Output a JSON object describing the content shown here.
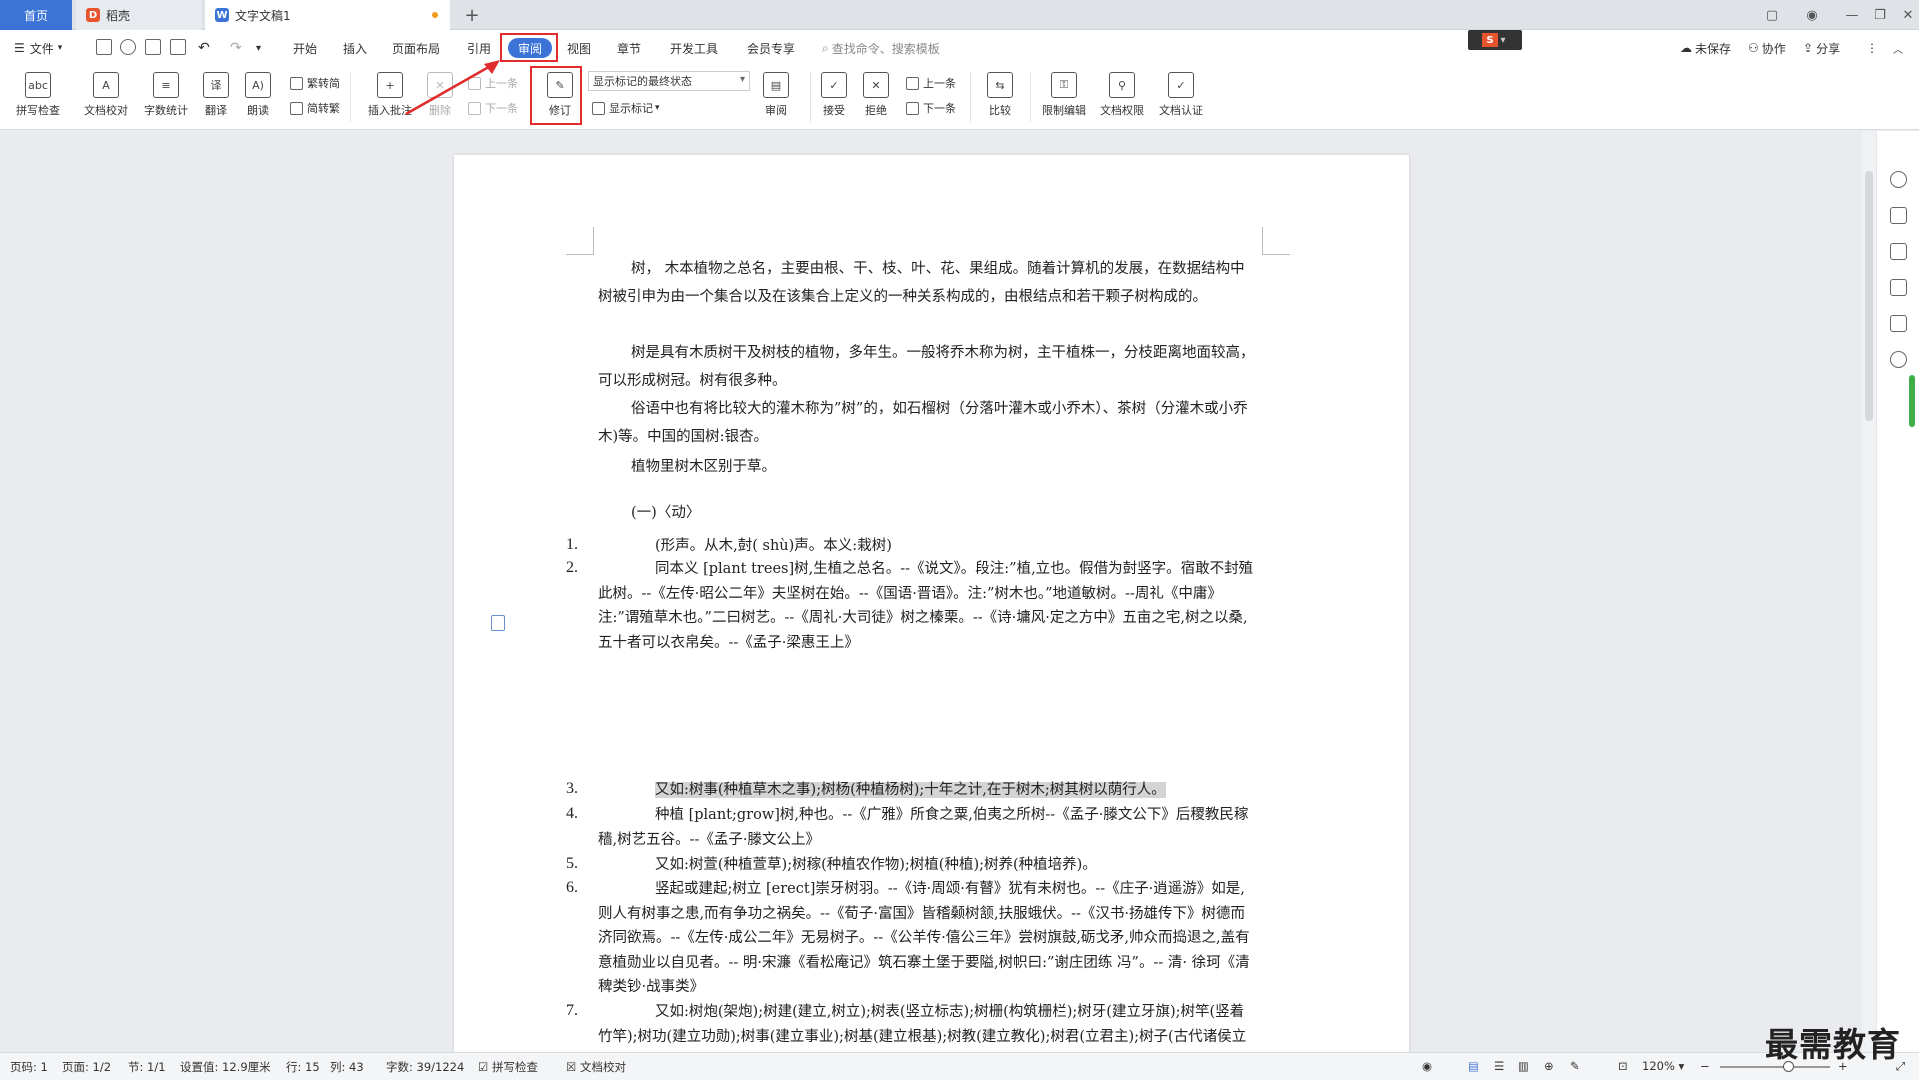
{
  "tabs": {
    "home": "首页",
    "daoke": "稻壳",
    "doc": "文字文稿1"
  },
  "menu": {
    "file": "文件",
    "items": [
      "开始",
      "插入",
      "页面布局",
      "引用",
      "审阅",
      "视图",
      "章节",
      "开发工具",
      "会员专享"
    ],
    "search": "查找命令、搜索模板",
    "unsaved": "未保存",
    "collab": "协作",
    "share": "分享"
  },
  "ribbon": {
    "spell": "拼写检查",
    "proof": "文档校对",
    "wordcount": "字数统计",
    "translate": "翻译",
    "read": "朗读",
    "trad": "繁转简",
    "simp": "简转繁",
    "insert_comment": "插入批注",
    "delete": "删除",
    "prev_comment": "上一条",
    "next_comment": "下一条",
    "revise": "修订",
    "markup_state": "显示标记的最终状态",
    "show_markup": "显示标记",
    "review": "审阅",
    "accept": "接受",
    "reject": "拒绝",
    "prev_change": "上一条",
    "next_change": "下一条",
    "compare": "比较",
    "restrict": "限制编辑",
    "permission": "文档权限",
    "certify": "文档认证"
  },
  "document": {
    "p1": "树， 木本植物之总名，主要由根、干、枝、叶、花、果组成。随着计算机的发展，在数据结构中树被引申为由一个集合以及在该集合上定义的一种关系构成的，由根结点和若干颗子树构成的。",
    "p2": "树是具有木质树干及树枝的植物，多年生。一般将乔木称为树，主干植株一，分枝距离地面较高，可以形成树冠。树有很多种。",
    "p3": "俗语中也有将比较大的灌木称为”树”的，如石榴树（分落叶灌木或小乔木）、茶树（分灌木或小乔木)等。中国的国树:银杏。",
    "p4": "植物里树木区别于草。",
    "p5": "(一)〈动〉",
    "list": [
      {
        "n": "1.",
        "t": "(形声。从木,尌( shù)声。本义:栽树)"
      },
      {
        "n": "2.",
        "t": "同本义 [plant trees]树,生植之总名。--《说文》。段注:”植,立也。假借为尌竖字。宿敢不封殖此树。--《左传·昭公二年》夫坚树在始。--《国语·晋语》。注:”树木也。”地道敏树。--周礼《中庸》注:”谓殖草木也。”二曰树艺。--《周礼·大司徒》树之榛栗。--《诗·墉风·定之方中》五亩之宅,树之以桑,五十者可以衣帛矣。--《孟子·梁惠王上》"
      },
      {
        "n": "3.",
        "t": "又如:树事(种植草木之事);树杨(种植杨树);十年之计,在于树木;树其树以荫行人。"
      },
      {
        "n": "4.",
        "t": "种植 [plant;grow]树,种也。--《广雅》所食之粟,伯夷之所树--《孟子·滕文公下》后稷教民稼穑,树艺五谷。--《孟子·滕文公上》"
      },
      {
        "n": "5.",
        "t": "又如:树萱(种植萱草);树稼(种植农作物);树植(种植);树养(种植培养)。"
      },
      {
        "n": "6.",
        "t": "竖起或建起;树立 [erect]崇牙树羽。--《诗·周颂·有瞽》犹有未树也。--《庄子·逍遥游》如是,则人有树事之患,而有争功之祸矣。--《荀子·富国》皆稽颡树颔,扶服蛾伏。--《汉书·扬雄传下》树德而济同欲焉。--《左传·成公二年》无易树子。--《公羊传·僖公三年》尝树旗鼓,砺戈矛,帅众而捣退之,盖有意植勋业以自见者。-- 明·宋濂《看松庵记》筑石寨土堡于要隘,树帜曰:”谢庄团练 冯”。-- 清· 徐珂《清稗类钞·战事类》"
      },
      {
        "n": "7.",
        "t": "又如:树炮(架炮);树建(建立,树立);树表(竖立标志);树栅(构筑栅栏);树牙(建立牙旗);树竿(竖着竹竿);树功(建立功勋);树事(建立事业);树基(建立根基);树教(建立教化);树君(立君主);树子(古代诸侯立为世子的嫡子)。"
      }
    ]
  },
  "status": {
    "page": "页码: 1",
    "pages": "页面: 1/2",
    "section": "节: 1/1",
    "setting": "设置值: 12.9厘米",
    "row": "行: 15",
    "col": "列: 43",
    "words": "字数: 39/1224",
    "spell": "拼写检查",
    "proof": "文档校对",
    "zoom": "120%"
  },
  "watermark": "最需教育",
  "colors": {
    "accent": "#3b73d6",
    "highlight_box": "#e02c2c"
  }
}
